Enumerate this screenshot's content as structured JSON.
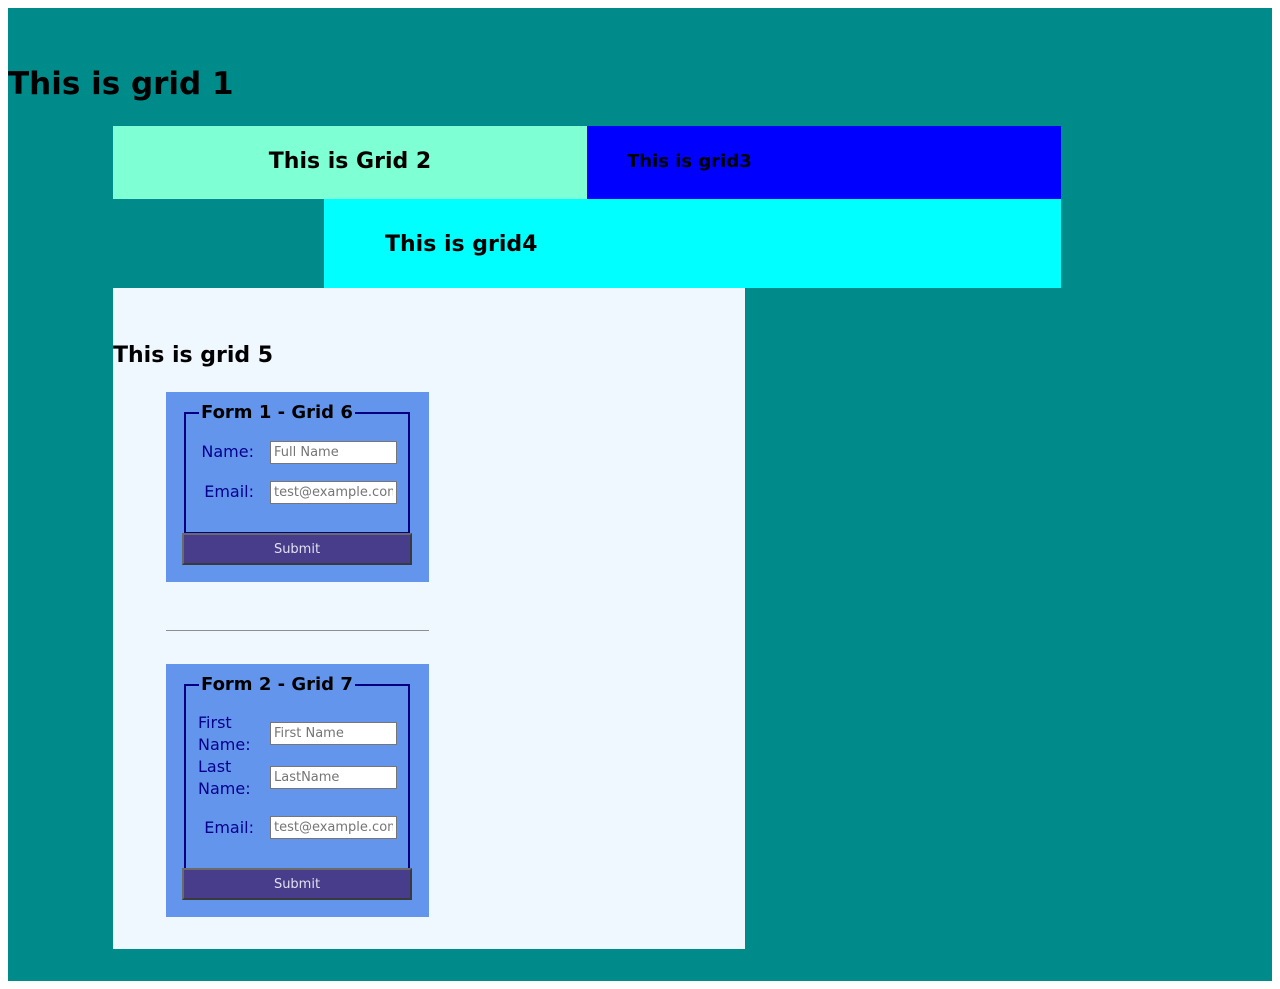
{
  "grid1": {
    "title": "This is grid 1"
  },
  "grid2": {
    "title": "This is Grid 2"
  },
  "grid3": {
    "title": "This is grid3"
  },
  "grid4": {
    "title": "This is grid4"
  },
  "grid5": {
    "title": "This is grid 5"
  },
  "form1": {
    "legend": "Form 1 - Grid 6",
    "name_label": "Name:",
    "name_placeholder": "Full Name",
    "email_label": "Email:",
    "email_placeholder": "test@example.com",
    "submit_label": "Submit"
  },
  "form2": {
    "legend": "Form 2 - Grid 7",
    "first_name_label": "First Name:",
    "first_name_placeholder": "First Name",
    "last_name_label": "Last Name:",
    "last_name_placeholder": "LastName",
    "email_label": "Email:",
    "email_placeholder": "test@example.com",
    "submit_label": "Submit"
  },
  "colors": {
    "grid1_bg": "#008b8b",
    "grid2_bg": "#7fffd4",
    "grid3_bg": "#0000ff",
    "grid4_bg": "#00ffff",
    "grid5_bg": "#f0f8ff",
    "form_bg": "#6495ed",
    "submit_bg": "#483d8b",
    "label_color": "#00008b"
  }
}
